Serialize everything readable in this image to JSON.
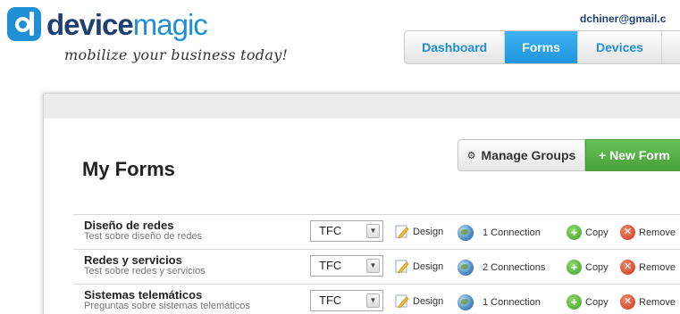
{
  "header": {
    "brand_part1": "device",
    "brand_part2": "magic",
    "tagline": "mobilize your business today!",
    "user_email": "dchiner@gmail.c",
    "colors": {
      "brand_dark": "#1d3f72",
      "brand_blue": "#1f8fd6"
    }
  },
  "nav": {
    "tabs": [
      {
        "label": "Dashboard",
        "active": false
      },
      {
        "label": "Forms",
        "active": true
      },
      {
        "label": "Devices",
        "active": false
      }
    ]
  },
  "main": {
    "title": "My Forms",
    "manage_groups_label": "Manage Groups",
    "new_form_label": "+ New Form"
  },
  "forms": [
    {
      "name": "Diseño de redes",
      "description": "Test sobre diseño de redes",
      "group": "TFC",
      "design_label": "Design",
      "connections": "1 Connection",
      "copy_label": "Copy",
      "remove_label": "Remove"
    },
    {
      "name": "Redes y servicios",
      "description": "Test sobre redes y servicios",
      "group": "TFC",
      "design_label": "Design",
      "connections": "2 Connections",
      "copy_label": "Copy",
      "remove_label": "Remove"
    },
    {
      "name": "Sistemas telemáticos",
      "description": "Preguntas sobre sistemas telemáticos",
      "group": "TFC",
      "design_label": "Design",
      "connections": "1 Connection",
      "copy_label": "Copy",
      "remove_label": "Remove"
    }
  ],
  "icons": {
    "design": "pencil-icon",
    "connections": "globe-icon",
    "copy": "plus-circle-icon",
    "remove": "x-circle-icon",
    "manage_groups": "gear-icon"
  }
}
